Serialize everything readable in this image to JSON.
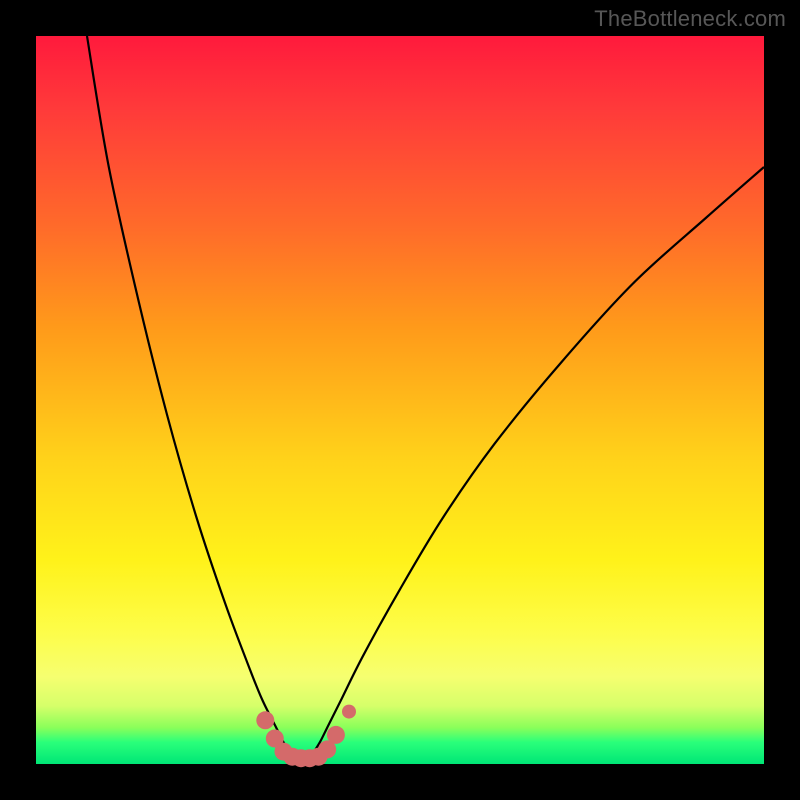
{
  "watermark": "TheBottleneck.com",
  "colors": {
    "frame_bg": "#000000",
    "curve_stroke": "#000000",
    "marker_fill": "#d46a6a",
    "marker_outlier_fill": "#d46a6a"
  },
  "chart_data": {
    "type": "line",
    "title": "",
    "xlabel": "",
    "ylabel": "",
    "xlim": [
      0,
      100
    ],
    "ylim": [
      0,
      100
    ],
    "grid": false,
    "legend": false,
    "note": "No axis ticks or numeric labels are visible; curve y-values are estimated as percentage of plot height from top (0 = top, 100 = bottom). The curve is a V-shaped bottleneck profile with minimum around x≈36.",
    "series": [
      {
        "name": "bottleneck-curve",
        "x": [
          7,
          10,
          14,
          18,
          22,
          26,
          29,
          31,
          33,
          34,
          35,
          36,
          37,
          38,
          39,
          40,
          42,
          45,
          50,
          56,
          63,
          72,
          82,
          92,
          100
        ],
        "y": [
          0,
          18,
          36,
          52,
          66,
          78,
          86,
          91,
          95,
          97,
          98.5,
          99.2,
          99.2,
          98.5,
          97,
          95,
          91,
          85,
          76,
          66,
          56,
          45,
          34,
          25,
          18
        ]
      }
    ],
    "markers": {
      "name": "valley-markers",
      "note": "salmon circular markers clustered around the valley floor plus one slightly separated on the right ascending arm",
      "x": [
        31.5,
        32.8,
        34.0,
        35.2,
        36.4,
        37.6,
        38.8,
        40.0,
        41.2,
        43.0
      ],
      "y": [
        94.0,
        96.5,
        98.3,
        99.0,
        99.2,
        99.2,
        99.0,
        98.0,
        96.0,
        92.8
      ],
      "r": [
        9,
        9,
        9,
        9,
        9,
        9,
        9,
        9,
        9,
        7
      ]
    }
  }
}
